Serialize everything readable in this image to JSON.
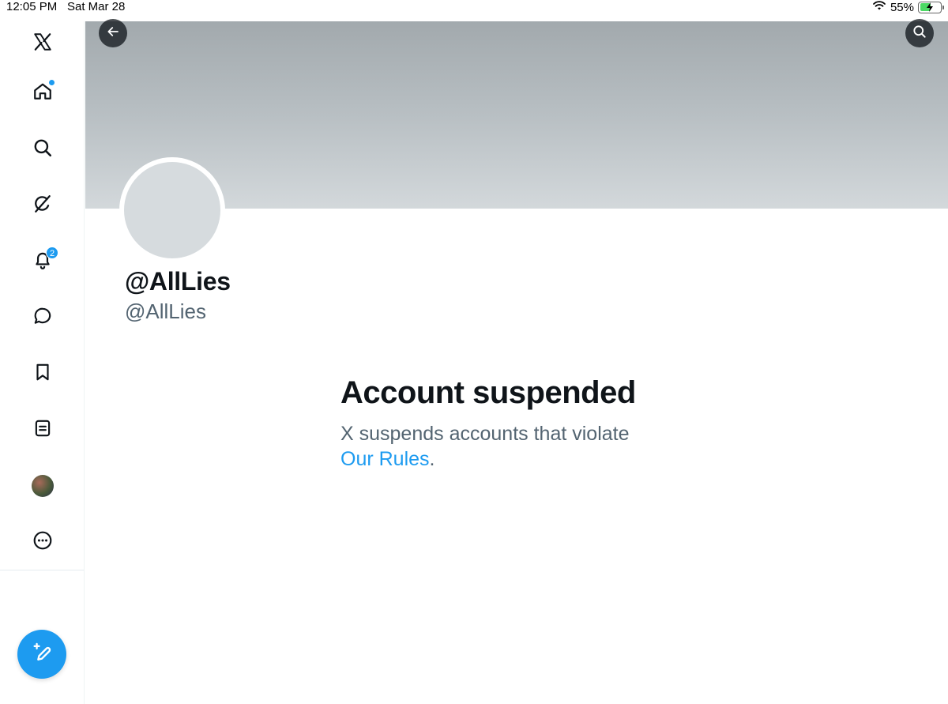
{
  "status_bar": {
    "time": "12:05 PM",
    "date": "Sat Mar 28",
    "battery": "55%",
    "wifi_icon": "wifi-icon",
    "battery_icon": "battery-charging-icon"
  },
  "sidebar": {
    "items": [
      {
        "name": "x-logo",
        "icon": "x-logo-icon"
      },
      {
        "name": "home",
        "icon": "home-icon",
        "has_dot": true
      },
      {
        "name": "explore",
        "icon": "search-icon"
      },
      {
        "name": "grok",
        "icon": "grok-icon"
      },
      {
        "name": "notifications",
        "icon": "bell-icon",
        "badge": "2"
      },
      {
        "name": "messages",
        "icon": "message-bubble-icon"
      },
      {
        "name": "bookmarks",
        "icon": "bookmark-icon"
      },
      {
        "name": "lists",
        "icon": "list-icon"
      },
      {
        "name": "profile",
        "icon": "avatar"
      },
      {
        "name": "more",
        "icon": "more-circle-icon"
      }
    ],
    "notification_badge": "2",
    "compose_icon": "compose-icon"
  },
  "header": {
    "back_icon": "back-arrow-icon",
    "search_icon": "search-icon"
  },
  "profile": {
    "display_name": "@AllLies",
    "handle": "@AllLies"
  },
  "suspension": {
    "title": "Account suspended",
    "message": "X suspends accounts that violate",
    "link_text": "Our Rules",
    "trailing": "."
  },
  "colors": {
    "accent": "#1d9bf0",
    "text_primary": "#0f1419",
    "text_secondary": "#536471"
  }
}
